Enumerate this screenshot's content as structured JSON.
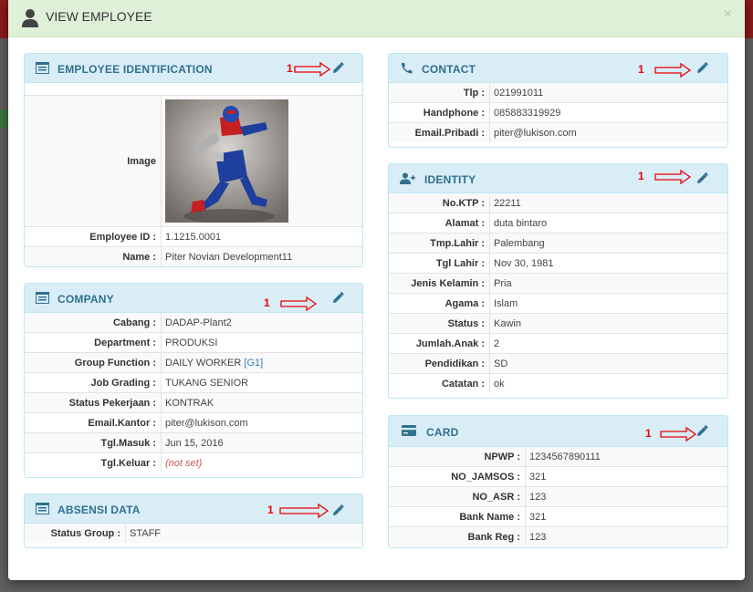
{
  "modal": {
    "title": "VIEW EMPLOYEE",
    "close_label": "×"
  },
  "annotation_marker": "1",
  "employee_identification": {
    "title": "EMPLOYEE IDENTIFICATION",
    "image_label": "Image",
    "rows": [
      {
        "label": "Employee ID :",
        "value": "1.1215.0001"
      },
      {
        "label": "Name :",
        "value": "Piter Novian Development11"
      }
    ]
  },
  "company": {
    "title": "COMPANY",
    "rows": [
      {
        "label": "Cabang :",
        "value": "DADAP-Plant2"
      },
      {
        "label": "Department :",
        "value": "PRODUKSI"
      },
      {
        "label": "Group Function :",
        "value": "DAILY WORKER",
        "link": "[G1]"
      },
      {
        "label": "Job Grading :",
        "value": "TUKANG SENIOR"
      },
      {
        "label": "Status Pekerjaan :",
        "value": "KONTRAK"
      },
      {
        "label": "Email.Kantor :",
        "value": "piter@lukison.com"
      },
      {
        "label": "Tgl.Masuk :",
        "value": "Jun 15, 2016"
      },
      {
        "label": "Tgl.Keluar :",
        "value": "(not set)"
      }
    ]
  },
  "absensi": {
    "title": "ABSENSI DATA",
    "rows": [
      {
        "label": "Status Group :",
        "value": "STAFF"
      }
    ]
  },
  "contact": {
    "title": "CONTACT",
    "rows": [
      {
        "label": "Tlp :",
        "value": "021991011"
      },
      {
        "label": "Handphone :",
        "value": "085883319929"
      },
      {
        "label": "Email.Pribadi :",
        "value": "piter@lukison.com"
      }
    ]
  },
  "identity": {
    "title": "IDENTITY",
    "rows": [
      {
        "label": "No.KTP :",
        "value": "22211"
      },
      {
        "label": "Alamat :",
        "value": "duta bintaro"
      },
      {
        "label": "Tmp.Lahir :",
        "value": "Palembang"
      },
      {
        "label": "Tgl Lahir :",
        "value": "Nov 30, 1981"
      },
      {
        "label": "Jenis Kelamin :",
        "value": "Pria"
      },
      {
        "label": "Agama :",
        "value": "Islam"
      },
      {
        "label": "Status :",
        "value": "Kawin"
      },
      {
        "label": "Jumlah.Anak :",
        "value": "2"
      },
      {
        "label": "Pendidikan :",
        "value": "SD"
      },
      {
        "label": "Catatan :",
        "value": "ok"
      }
    ]
  },
  "card": {
    "title": "CARD",
    "rows": [
      {
        "label": "NPWP :",
        "value": "1234567890111"
      },
      {
        "label": "NO_JAMSOS :",
        "value": "321"
      },
      {
        "label": "NO_ASR :",
        "value": "123"
      },
      {
        "label": "Bank Name :",
        "value": "321"
      },
      {
        "label": "Bank Reg :",
        "value": "123"
      }
    ]
  },
  "icons": {
    "header": "user-icon",
    "employee_identification": "list-alt-icon",
    "company": "list-alt-icon",
    "absensi": "list-alt-icon",
    "contact": "phone-icon",
    "identity": "user-plus-icon",
    "card": "credit-card-icon",
    "edit": "pencil-icon"
  },
  "colors": {
    "header_bg": "#dff0d8",
    "panel_heading_bg": "#d9edf7",
    "panel_title": "#31708f",
    "annotation": "#e00000"
  }
}
